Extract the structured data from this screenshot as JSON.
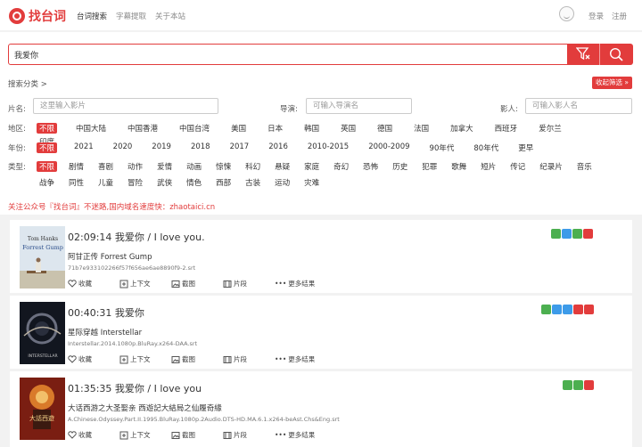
{
  "header": {
    "logo_text": "找台词",
    "nav": [
      "台词搜索",
      "字幕提取",
      "关于本站"
    ],
    "login": "登录",
    "register": "注册"
  },
  "search": {
    "query": "我爱你",
    "category_label": "搜索分类 >",
    "collapse_label": "收起筛选 »"
  },
  "filters": {
    "title_label": "片名:",
    "title_placeholder": "这里输入影片",
    "director_label": "导演:",
    "director_placeholder": "可输入导演名",
    "actor_label": "影人:",
    "actor_placeholder": "可输入影人名",
    "region_label": "地区:",
    "region_options": [
      "不限",
      "中国大陆",
      "中国香港",
      "中国台湾",
      "美国",
      "日本",
      "韩国",
      "英国",
      "德国",
      "法国",
      "加拿大",
      "西班牙",
      "爱尔兰",
      "印度"
    ],
    "year_label": "年份:",
    "year_options": [
      "不限",
      "2021",
      "2020",
      "2019",
      "2018",
      "2017",
      "2016",
      "2010-2015",
      "2000-2009",
      "90年代",
      "80年代",
      "更早"
    ],
    "type_label": "类型:",
    "type_options_row1": [
      "不限",
      "剧情",
      "喜剧",
      "动作",
      "爱情",
      "动画",
      "惊悚",
      "科幻",
      "悬疑",
      "家庭",
      "奇幻",
      "恐怖",
      "历史",
      "犯罪",
      "歌舞",
      "短片",
      "传记",
      "纪录片",
      "音乐"
    ],
    "type_options_row2": [
      "战争",
      "同性",
      "儿童",
      "冒险",
      "武侠",
      "情色",
      "西部",
      "古装",
      "运动",
      "灾难"
    ]
  },
  "notice": "关注公众号『找台词』不迷路,国内域名速度快：zhaotaici.cn",
  "actions_labels": {
    "favorite": "收藏",
    "context": "上下文",
    "screenshot": "截图",
    "clip": "片段",
    "more": "更多结果"
  },
  "results": [
    {
      "time_line": "02:09:14 我爱你 / I love you.",
      "title": "阿甘正传 Forrest Gump",
      "file": "71b7e933102266f57f656ae6ae8890f9-2.srt",
      "poster_text": "Forrest Gump"
    },
    {
      "time_line": "00:40:31 我爱你",
      "title": "星际穿越 Interstellar",
      "file": "Interstellar.2014.1080p.BluRay.x264-DAA.srt",
      "poster_text": "INTERSTELLAR"
    },
    {
      "time_line": "01:35:35 我爱你 / I love you",
      "title": "大话西游之大圣娶亲 西遊記大結局之仙履奇緣",
      "file": "A.Chinese.Odyssey.Part.II.1995.BluRay.1080p.2Audio.DTS-HD.MA.6.1.x264-beAst.Chs&Eng.srt",
      "poster_text": "大話西遊"
    }
  ],
  "colors": {
    "accent": "#e23c3c",
    "badge_green": "#4caf50",
    "badge_blue": "#3d9be9",
    "badge_red": "#e23c3c"
  }
}
